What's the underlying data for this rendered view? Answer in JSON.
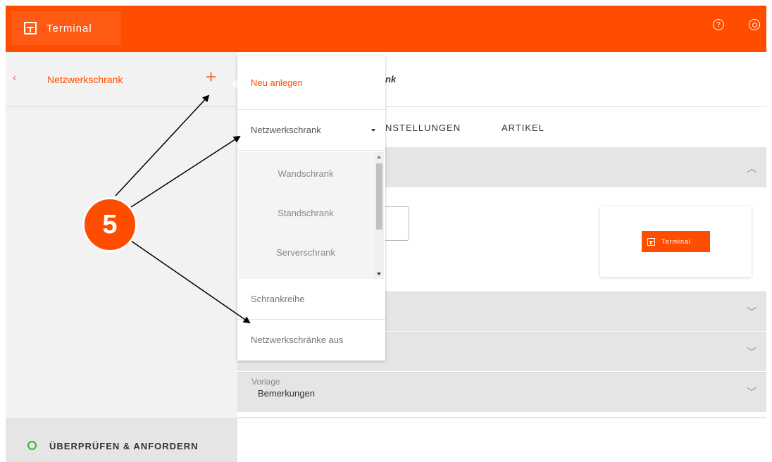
{
  "app": {
    "brand_name": "Terminal",
    "accent_color": "#ff4d00"
  },
  "topbar": {
    "help_icon": "help-icon",
    "settings_icon": "settings-icon"
  },
  "sidebar": {
    "title": "Netzwerkschrank",
    "back_icon": "chevron-left-icon",
    "add_icon": "plus-icon",
    "back_glyph": "‹",
    "add_glyph": "+",
    "footer_label": "ÜBERPRÜFEN & ANFORDERN",
    "status_color": "#2eb82e"
  },
  "main": {
    "header_text": "nk",
    "tabs": [
      {
        "label": "NSTELLUNGEN"
      },
      {
        "label": "ARTIKEL"
      }
    ],
    "logo_card": {
      "brand_name": "Terminal"
    },
    "panel_4": {
      "label": "Vorlage",
      "value": "Bemerkungen"
    }
  },
  "menu": {
    "new_label": "Neu anlegen",
    "selected_value": "Netzwerkschrank",
    "options": [
      "Wandschrank",
      "Standschrank",
      "Serverschrank"
    ],
    "rows_label": "Schrankreihe",
    "off_label": "Netzwerkschränke aus"
  },
  "annotation": {
    "step_number": "5"
  }
}
